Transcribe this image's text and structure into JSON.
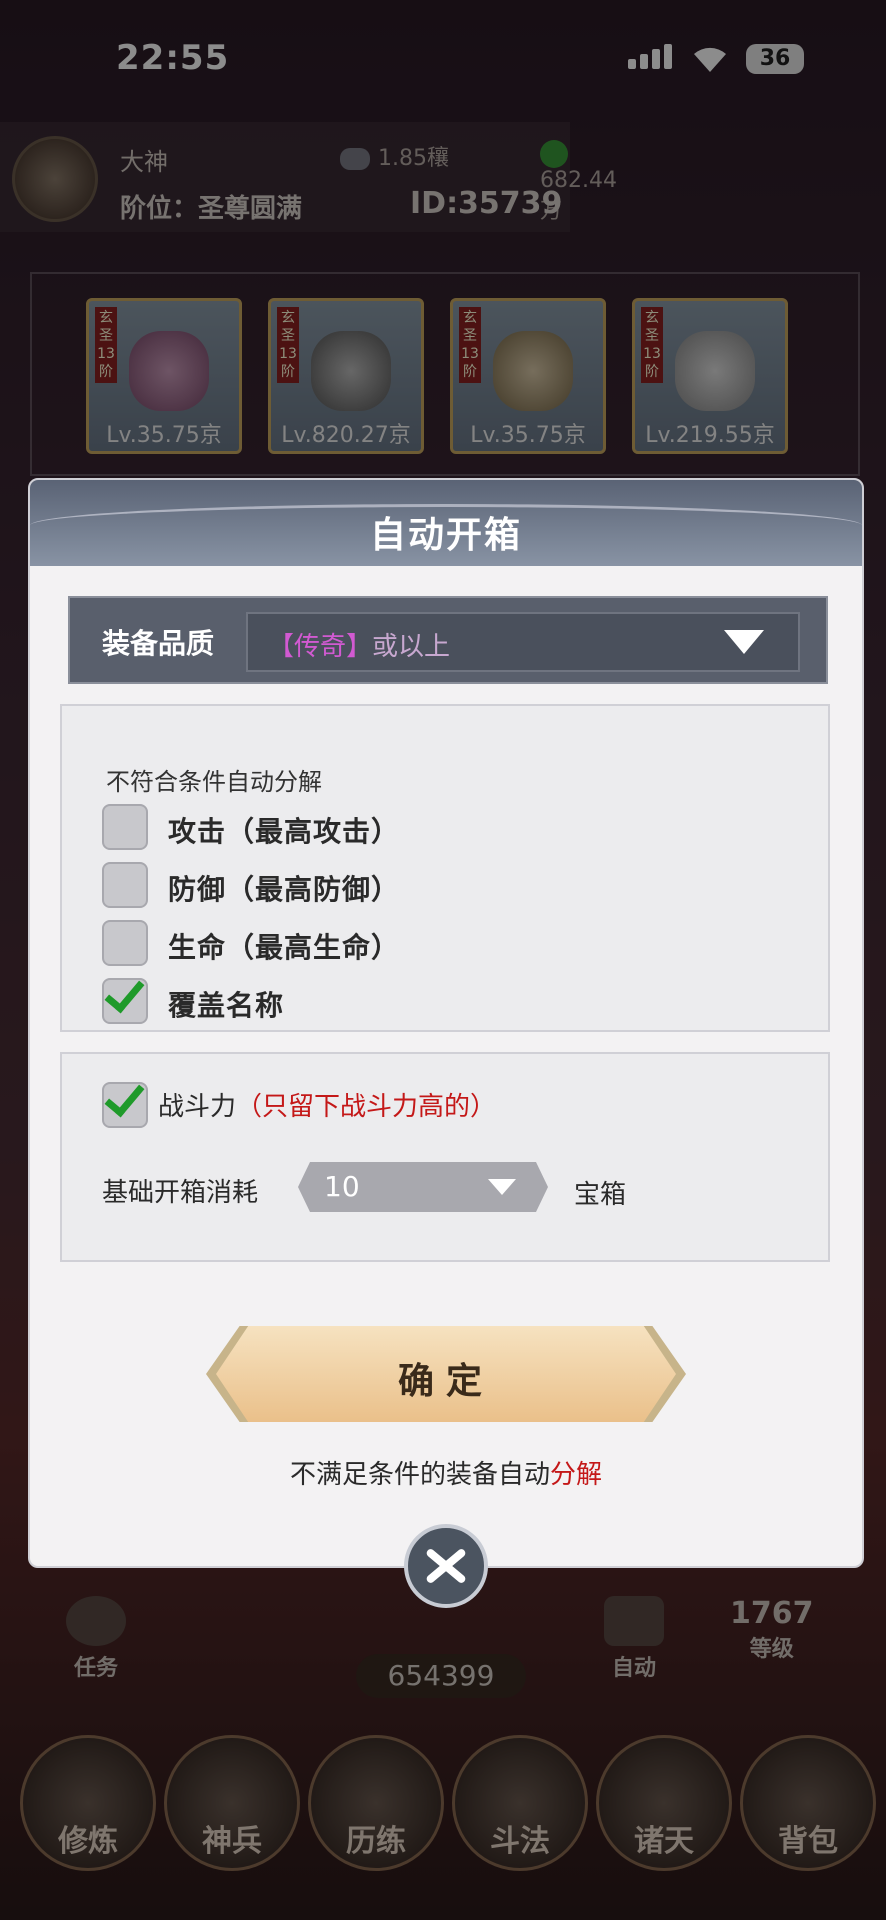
{
  "status_bar": {
    "time": "22:55",
    "battery": "36"
  },
  "player": {
    "name": "大神",
    "rank": "阶位：圣尊圆满",
    "id": "ID:35739",
    "gems": "1.85穰",
    "jade": "682.44万"
  },
  "equipment": [
    {
      "lv": "Lv.35.75京",
      "tag": "玄圣13阶"
    },
    {
      "lv": "Lv.820.27京",
      "tag": "玄圣13阶"
    },
    {
      "lv": "Lv.35.75京",
      "tag": "玄圣13阶"
    },
    {
      "lv": "Lv.219.55京",
      "tag": "玄圣13阶"
    }
  ],
  "hud": {
    "coins": "654399",
    "task": "任务",
    "auto": "自动",
    "level_num": "1767",
    "level": "等级"
  },
  "nav": [
    "修炼",
    "神兵",
    "历练",
    "斗法",
    "诸天",
    "背包"
  ],
  "dialog": {
    "title": "自动开箱",
    "quality_label": "装备品质",
    "quality_value_bracket": "【传奇】",
    "quality_value_rest": "或以上",
    "note": "不符合条件自动分解",
    "options": [
      {
        "label": "攻击（最高攻击）",
        "checked": false
      },
      {
        "label": "防御（最高防御）",
        "checked": false
      },
      {
        "label": "生命（最高生命）",
        "checked": false
      },
      {
        "label": "覆盖名称",
        "checked": true
      }
    ],
    "power_label": "战斗力",
    "power_note": "（只留下战斗力高的）",
    "power_checked": true,
    "cost_label": "基础开箱消耗",
    "cost_value": "10",
    "cost_unit": "宝箱",
    "confirm": "确定",
    "hint_main": "不满足条件的装备自动",
    "hint_red": "分解"
  },
  "colors": {
    "legend_purple": "#d25ad2",
    "warning_red": "#c41818",
    "check_green": "#1f9a2a"
  }
}
